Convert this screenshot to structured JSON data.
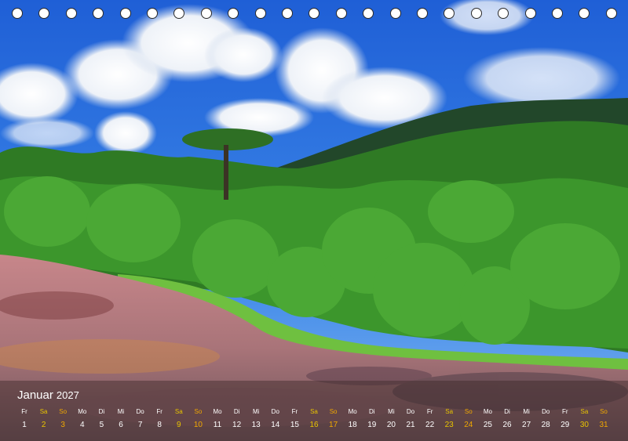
{
  "calendar": {
    "month": "Januar",
    "year": "2027",
    "days": [
      {
        "dn": "Fr",
        "d": "1",
        "t": ""
      },
      {
        "dn": "Sa",
        "d": "2",
        "t": "sa"
      },
      {
        "dn": "So",
        "d": "3",
        "t": "so"
      },
      {
        "dn": "Mo",
        "d": "4",
        "t": ""
      },
      {
        "dn": "Di",
        "d": "5",
        "t": ""
      },
      {
        "dn": "Mi",
        "d": "6",
        "t": ""
      },
      {
        "dn": "Do",
        "d": "7",
        "t": ""
      },
      {
        "dn": "Fr",
        "d": "8",
        "t": ""
      },
      {
        "dn": "Sa",
        "d": "9",
        "t": "sa"
      },
      {
        "dn": "So",
        "d": "10",
        "t": "so"
      },
      {
        "dn": "Mo",
        "d": "11",
        "t": ""
      },
      {
        "dn": "Di",
        "d": "12",
        "t": ""
      },
      {
        "dn": "Mi",
        "d": "13",
        "t": ""
      },
      {
        "dn": "Do",
        "d": "14",
        "t": ""
      },
      {
        "dn": "Fr",
        "d": "15",
        "t": ""
      },
      {
        "dn": "Sa",
        "d": "16",
        "t": "sa"
      },
      {
        "dn": "So",
        "d": "17",
        "t": "so"
      },
      {
        "dn": "Mo",
        "d": "18",
        "t": ""
      },
      {
        "dn": "Di",
        "d": "19",
        "t": ""
      },
      {
        "dn": "Mi",
        "d": "20",
        "t": ""
      },
      {
        "dn": "Do",
        "d": "21",
        "t": ""
      },
      {
        "dn": "Fr",
        "d": "22",
        "t": ""
      },
      {
        "dn": "Sa",
        "d": "23",
        "t": "sa"
      },
      {
        "dn": "So",
        "d": "24",
        "t": "so"
      },
      {
        "dn": "Mo",
        "d": "25",
        "t": ""
      },
      {
        "dn": "Di",
        "d": "26",
        "t": ""
      },
      {
        "dn": "Mi",
        "d": "27",
        "t": ""
      },
      {
        "dn": "Do",
        "d": "28",
        "t": ""
      },
      {
        "dn": "Fr",
        "d": "29",
        "t": ""
      },
      {
        "dn": "Sa",
        "d": "30",
        "t": "sa"
      },
      {
        "dn": "So",
        "d": "31",
        "t": "so"
      }
    ]
  },
  "colors": {
    "weekday": "#ffffff",
    "saturday": "#e8c400",
    "sunday": "#f0a800"
  }
}
